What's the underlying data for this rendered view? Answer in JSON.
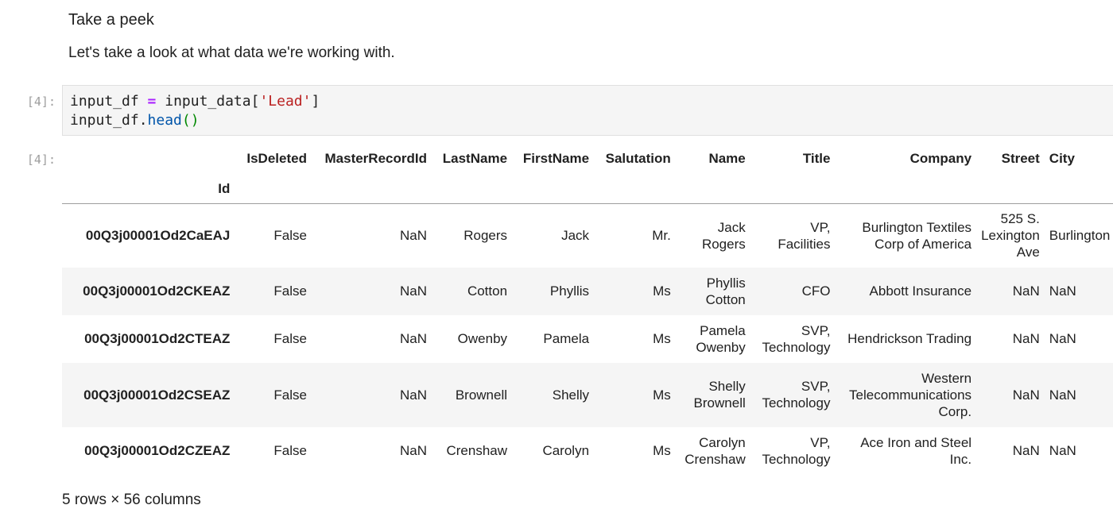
{
  "markdown": {
    "heading": "Take a peek",
    "paragraph": "Let's take a look at what data we're working with."
  },
  "code_cell": {
    "prompt": "[4]:",
    "line1": {
      "var": "input_df ",
      "op": "=",
      "call": " input_data[",
      "str": "'Lead'",
      "close": "]"
    },
    "line2": {
      "obj": "input_df.",
      "fn": "head",
      "parens": "()"
    }
  },
  "output_cell": {
    "prompt": "[4]:",
    "index_name": "Id",
    "columns": [
      "IsDeleted",
      "MasterRecordId",
      "LastName",
      "FirstName",
      "Salutation",
      "Name",
      "Title",
      "Company",
      "Street",
      "City"
    ],
    "rows": [
      {
        "id": "00Q3j00001Od2CaEAJ",
        "cells": [
          "False",
          "NaN",
          "Rogers",
          "Jack",
          "Mr.",
          "Jack Rogers",
          "VP, Facilities",
          "Burlington Textiles Corp of America",
          "525 S. Lexington Ave",
          "Burlington"
        ]
      },
      {
        "id": "00Q3j00001Od2CKEAZ",
        "cells": [
          "False",
          "NaN",
          "Cotton",
          "Phyllis",
          "Ms",
          "Phyllis Cotton",
          "CFO",
          "Abbott Insurance",
          "NaN",
          "NaN"
        ]
      },
      {
        "id": "00Q3j00001Od2CTEAZ",
        "cells": [
          "False",
          "NaN",
          "Owenby",
          "Pamela",
          "Ms",
          "Pamela Owenby",
          "SVP, Technology",
          "Hendrickson Trading",
          "NaN",
          "NaN"
        ]
      },
      {
        "id": "00Q3j00001Od2CSEAZ",
        "cells": [
          "False",
          "NaN",
          "Brownell",
          "Shelly",
          "Ms",
          "Shelly Brownell",
          "SVP, Technology",
          "Western Telecommunications Corp.",
          "NaN",
          "NaN"
        ]
      },
      {
        "id": "00Q3j00001Od2CZEAZ",
        "cells": [
          "False",
          "NaN",
          "Crenshaw",
          "Carolyn",
          "Ms",
          "Carolyn Crenshaw",
          "VP, Technology",
          "Ace Iron and Steel Inc.",
          "NaN",
          "NaN"
        ]
      }
    ],
    "summary": "5 rows × 56 columns"
  }
}
